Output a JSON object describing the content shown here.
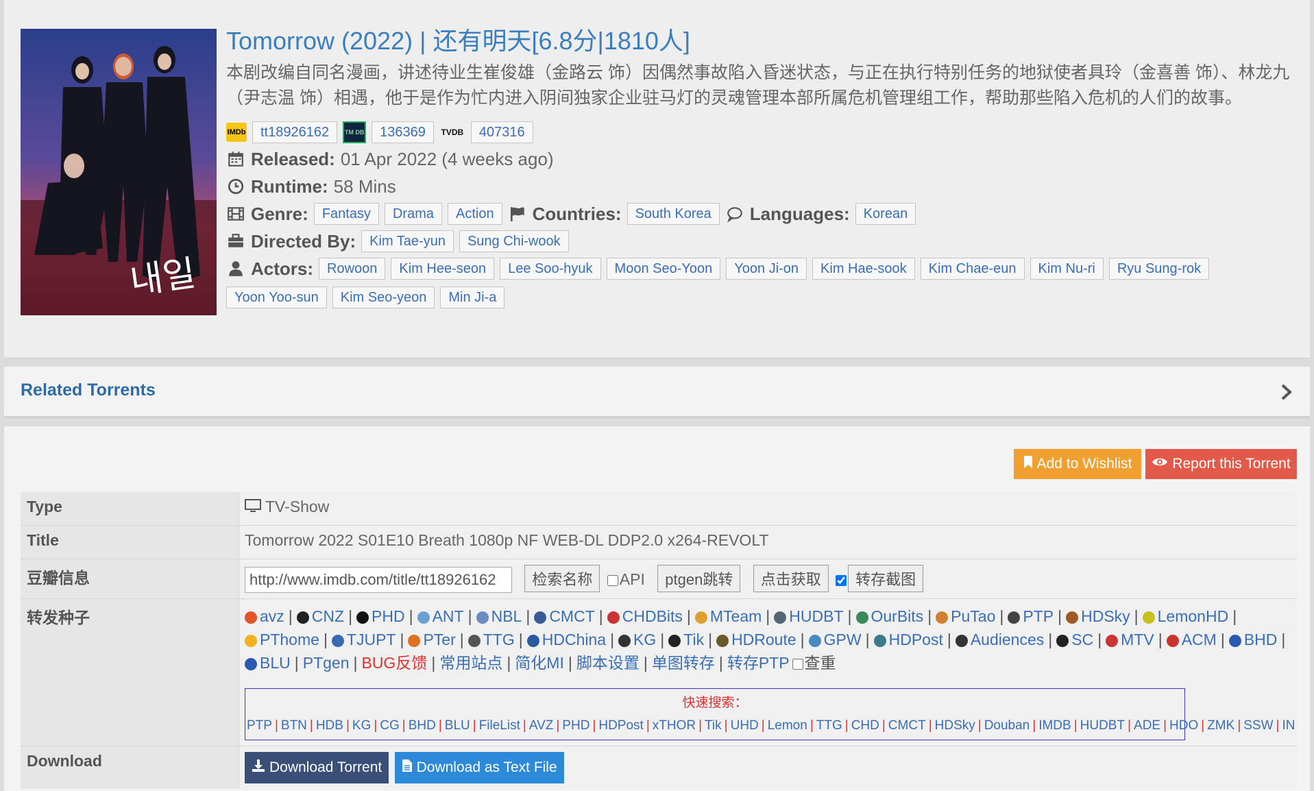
{
  "movie": {
    "title": "Tomorrow (2022) | 还有明天[6.8分|1810人]",
    "synopsis": "本剧改编自同名漫画，讲述待业生崔俊雄（金路云 饰）因偶然事故陷入昏迷状态，与正在执行特别任务的地狱使者具玲（金喜善 饰）、林龙九（尹志温 饰）相遇，他于是作为忙内进入阴间独家企业驻马灯的灵魂管理本部所属危机管理组工作，帮助那些陷入危机的人们的故事。",
    "ids": {
      "imdb_logo": "IMDb",
      "imdb": "tt18926162",
      "tmdb_logo": "TM DB",
      "tmdb": "136369",
      "tvdb_logo": "TVDB",
      "tvdb": "407316"
    },
    "released_label": "Released:",
    "released": "01 Apr 2022 (4 weeks ago)",
    "runtime_label": "Runtime:",
    "runtime": "58 Mins",
    "genre_label": "Genre:",
    "genres": [
      "Fantasy",
      "Drama",
      "Action"
    ],
    "countries_label": "Countries:",
    "countries": [
      "South Korea"
    ],
    "languages_label": "Languages:",
    "languages": [
      "Korean"
    ],
    "directed_label": "Directed By:",
    "directors": [
      "Kim Tae-yun",
      "Sung Chi-wook"
    ],
    "actors_label": "Actors:",
    "actors": [
      "Rowoon",
      "Kim Hee-seon",
      "Lee Soo-hyuk",
      "Moon Seo-Yoon",
      "Yoon Ji-on",
      "Kim Hae-sook",
      "Kim Chae-eun",
      "Kim Nu-ri",
      "Ryu Sung-rok",
      "Yoon Yoo-sun",
      "Kim Seo-yeon",
      "Min Ji-a"
    ],
    "poster_text": "내일"
  },
  "related": {
    "title": "Related Torrents"
  },
  "actions": {
    "wishlist": "Add to Wishlist",
    "report": "Report this Torrent"
  },
  "details": {
    "type_label": "Type",
    "type_value": "TV-Show",
    "title_label": "Title",
    "title_value": "Tomorrow 2022 S01E10 Breath 1080p NF WEB-DL DDP2.0 x264-REVOLT",
    "douban_label": "豆瓣信息",
    "douban_url": "http://www.imdb.com/title/tt18926162",
    "search_name_btn": "检索名称",
    "api_label": "API",
    "ptgen_btn": "ptgen跳转",
    "fetch_btn": "点击获取",
    "save_shots_label": "转存截图",
    "forward_label": "转发种子",
    "download_label": "Download"
  },
  "forward_sites": [
    {
      "name": "avz",
      "color": "#e0552a"
    },
    {
      "name": "CNZ",
      "color": "#222222"
    },
    {
      "name": "PHD",
      "color": "#111111"
    },
    {
      "name": "ANT",
      "color": "#6aa0d0"
    },
    {
      "name": "NBL",
      "color": "#6a8cc0"
    },
    {
      "name": "CMCT",
      "color": "#3a5a9a"
    },
    {
      "name": "CHDBits",
      "color": "#cc3333"
    },
    {
      "name": "MTeam",
      "color": "#e0a030"
    },
    {
      "name": "HUDBT",
      "color": "#556677"
    },
    {
      "name": "OurBits",
      "color": "#3a8a5a"
    },
    {
      "name": "PuTao",
      "color": "#d08030"
    },
    {
      "name": "PTP",
      "color": "#444444"
    },
    {
      "name": "HDSky",
      "color": "#a05a2a"
    },
    {
      "name": "LemonHD",
      "color": "#c8c020"
    },
    {
      "name": "PThome",
      "color": "#f0b020"
    },
    {
      "name": "TJUPT",
      "color": "#3a6ab0"
    },
    {
      "name": "PTer",
      "color": "#e07020"
    },
    {
      "name": "TTG",
      "color": "#555555"
    },
    {
      "name": "HDChina",
      "color": "#2a5aa0"
    },
    {
      "name": "KG",
      "color": "#333333"
    },
    {
      "name": "Tik",
      "color": "#222222"
    },
    {
      "name": "HDRoute",
      "color": "#6a5a2a"
    },
    {
      "name": "GPW",
      "color": "#4a8ac0"
    },
    {
      "name": "HDPost",
      "color": "#3a7a8a"
    },
    {
      "name": "Audiences",
      "color": "#333333"
    },
    {
      "name": "SC",
      "color": "#222222"
    },
    {
      "name": "MTV",
      "color": "#cc3333"
    },
    {
      "name": "ACM",
      "color": "#cc3333"
    },
    {
      "name": "BHD",
      "color": "#2a5ab0"
    },
    {
      "name": "BLU",
      "color": "#2a5ab0"
    }
  ],
  "forward_tools": [
    "PTgen",
    "BUG反馈",
    "常用站点",
    "简化MI",
    "脚本设置",
    "单图转存",
    "转存PTP"
  ],
  "dedupe_label": "查重",
  "quick_search": {
    "label": "快速搜索：",
    "sites": [
      "PTP",
      "BTN",
      "HDB",
      "KG",
      "CG",
      "BHD",
      "BLU",
      "FileList",
      "AVZ",
      "PHD",
      "HDPost",
      "xTHOR",
      "Tik",
      "UHD",
      "Lemon",
      "TTG",
      "CHD",
      "CMCT",
      "HDSky",
      "Douban",
      "IMDB",
      "HUDBT",
      "ADE",
      "HDO",
      "ZMK",
      "SSW",
      "IN"
    ]
  },
  "download": {
    "torrent": "Download Torrent",
    "text_file": "Download as Text File"
  },
  "colors": {
    "title_blue": "#3a7ebf",
    "link_blue": "#3a6eb4",
    "wishlist_orange": "#f0a030",
    "report_red": "#e35a4a",
    "download_dark": "#3a4f78",
    "download_blue": "#2d8ad8"
  }
}
